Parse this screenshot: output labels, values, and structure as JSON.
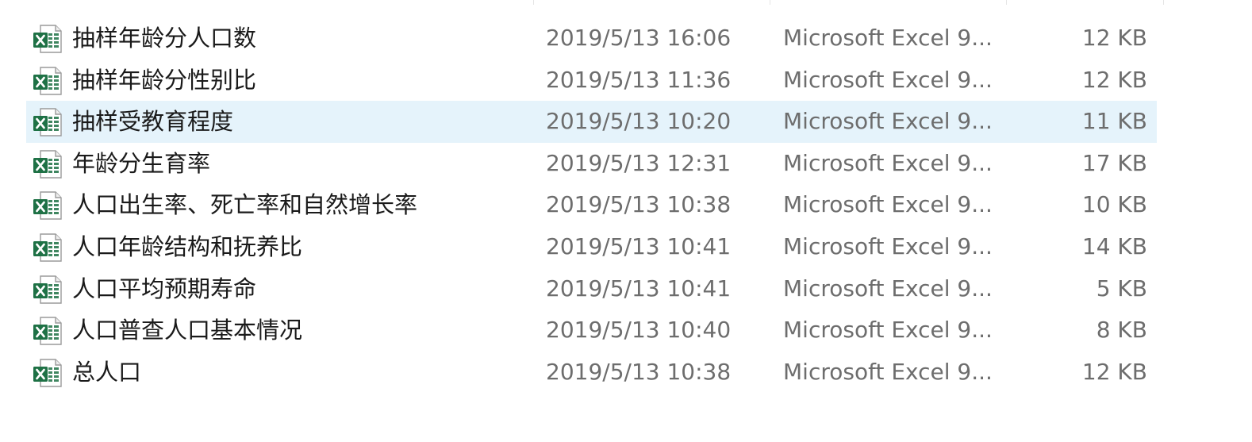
{
  "files": [
    {
      "name": "抽样年龄分人口数",
      "modified": "2019/5/13 16:06",
      "type": "Microsoft Excel 9...",
      "size": "12 KB",
      "selected": false,
      "icon": "excel-file-icon"
    },
    {
      "name": "抽样年龄分性别比",
      "modified": "2019/5/13 11:36",
      "type": "Microsoft Excel 9...",
      "size": "12 KB",
      "selected": false,
      "icon": "excel-file-icon"
    },
    {
      "name": "抽样受教育程度",
      "modified": "2019/5/13 10:20",
      "type": "Microsoft Excel 9...",
      "size": "11 KB",
      "selected": true,
      "icon": "excel-file-icon"
    },
    {
      "name": "年龄分生育率",
      "modified": "2019/5/13 12:31",
      "type": "Microsoft Excel 9...",
      "size": "17 KB",
      "selected": false,
      "icon": "excel-file-icon"
    },
    {
      "name": "人口出生率、死亡率和自然增长率",
      "modified": "2019/5/13 10:38",
      "type": "Microsoft Excel 9...",
      "size": "10 KB",
      "selected": false,
      "icon": "excel-file-icon"
    },
    {
      "name": "人口年龄结构和抚养比",
      "modified": "2019/5/13 10:41",
      "type": "Microsoft Excel 9...",
      "size": "14 KB",
      "selected": false,
      "icon": "excel-file-icon"
    },
    {
      "name": "人口平均预期寿命",
      "modified": "2019/5/13 10:41",
      "type": "Microsoft Excel 9...",
      "size": "5 KB",
      "selected": false,
      "icon": "excel-file-icon"
    },
    {
      "name": "人口普查人口基本情况",
      "modified": "2019/5/13 10:40",
      "type": "Microsoft Excel 9...",
      "size": "8 KB",
      "selected": false,
      "icon": "excel-file-icon"
    },
    {
      "name": "总人口",
      "modified": "2019/5/13 10:38",
      "type": "Microsoft Excel 9...",
      "size": "12 KB",
      "selected": false,
      "icon": "excel-file-icon"
    }
  ],
  "colors": {
    "selection_background": "#e5f3fb",
    "excel_green": "#1e7145",
    "name_text": "#1a1a1a",
    "detail_text": "#6d6d6d"
  }
}
